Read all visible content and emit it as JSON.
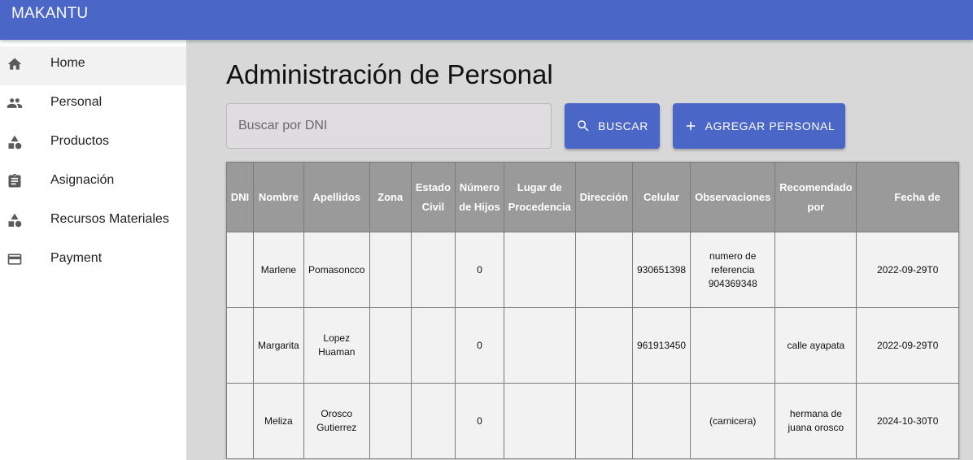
{
  "app": {
    "title": "MAKANTU"
  },
  "sidebar": {
    "items": [
      {
        "label": "Home",
        "icon": "home-icon",
        "active": true
      },
      {
        "label": "Personal",
        "icon": "people-icon",
        "active": false
      },
      {
        "label": "Productos",
        "icon": "category-icon",
        "active": false
      },
      {
        "label": "Asignación",
        "icon": "clipboard-icon",
        "active": false
      },
      {
        "label": "Recursos Materiales",
        "icon": "category-icon",
        "active": false
      },
      {
        "label": "Payment",
        "icon": "credit-card-icon",
        "active": false
      }
    ]
  },
  "page": {
    "title": "Administración de Personal",
    "search_placeholder": "Buscar por DNI",
    "search_value": "",
    "buscar_label": "BUSCAR",
    "agregar_label": "AGREGAR PERSONAL"
  },
  "colors": {
    "primary": "#4a66c6",
    "header_bg": "#9a9a9a",
    "main_bg": "#d9d8d9",
    "cell_bg": "#f2f2f2"
  },
  "table": {
    "headers": [
      "DNI",
      "Nombre",
      "Apellidos",
      "Zona",
      "Estado Civil",
      "Número de Hijos",
      "Lugar de Procedencia",
      "Dirección",
      "Celular",
      "Observaciones",
      "Recomendado por",
      "Fecha de"
    ],
    "rows": [
      [
        "",
        "Marlene",
        "Pomasoncco",
        "",
        "",
        "0",
        "",
        "",
        "930651398",
        "numero de referencia 904369348",
        "",
        "2022-09-29T0"
      ],
      [
        "",
        "Margarita",
        "Lopez Huaman",
        "",
        "",
        "0",
        "",
        "",
        "961913450",
        "",
        "calle ayapata",
        "2022-09-29T0"
      ],
      [
        "",
        "Meliza",
        "Orosco Gutierrez",
        "",
        "",
        "0",
        "",
        "",
        "",
        "(carnicera)",
        "hermana de juana orosco",
        "2024-10-30T0"
      ]
    ]
  }
}
